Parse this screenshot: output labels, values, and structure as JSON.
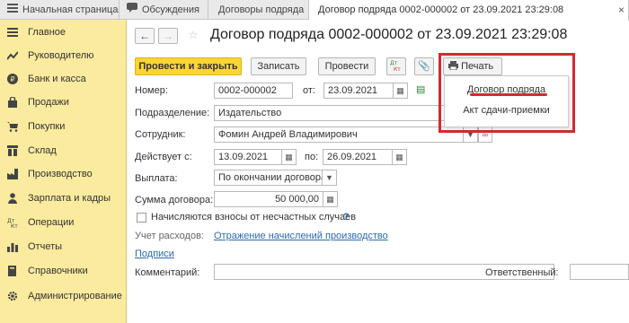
{
  "tabs": [
    {
      "label": "Начальная страница",
      "active": false
    },
    {
      "label": "Обсуждения",
      "active": false
    },
    {
      "label": "Договоры подряда",
      "active": false
    },
    {
      "label": "Договор подряда 0002-000002 от 23.09.2021 23:29:08",
      "active": true
    }
  ],
  "tab_close": "×",
  "sidebar": {
    "items": [
      {
        "label": "Главное",
        "icon": "menu-icon"
      },
      {
        "label": "Руководителю",
        "icon": "chart-trend-icon"
      },
      {
        "label": "Банк и касса",
        "icon": "coin-icon"
      },
      {
        "label": "Продажи",
        "icon": "bag-icon"
      },
      {
        "label": "Покупки",
        "icon": "cart-icon"
      },
      {
        "label": "Склад",
        "icon": "warehouse-icon"
      },
      {
        "label": "Производство",
        "icon": "factory-icon"
      },
      {
        "label": "Зарплата и кадры",
        "icon": "people-icon"
      },
      {
        "label": "Операции",
        "icon": "dt-kt-icon"
      },
      {
        "label": "Отчеты",
        "icon": "bar-chart-icon"
      },
      {
        "label": "Справочники",
        "icon": "book-icon"
      },
      {
        "label": "Администрирование",
        "icon": "gear-icon"
      }
    ]
  },
  "header": {
    "title": "Договор подряда 0002-000002 от 23.09.2021 23:29:08"
  },
  "toolbar": {
    "post_close": "Провести и закрыть",
    "save": "Записать",
    "post": "Провести",
    "dtkt": "Дт Кт",
    "print": "Печать"
  },
  "form": {
    "number_label": "Номер:",
    "number_value": "0002-000002",
    "from_label": "от:",
    "date_value": "23.09.2021",
    "division_label": "Подразделение:",
    "division_value": "Издательство",
    "employee_label": "Сотрудник:",
    "employee_value": "Фомин Андрей Владимирович",
    "valid_from_label": "Действует с:",
    "valid_from_value": "13.09.2021",
    "valid_to_label": "по:",
    "valid_to_value": "26.09.2021",
    "payment_label": "Выплата:",
    "payment_value": "По окончании договора",
    "sum_label": "Сумма договора:",
    "sum_value": "50 000,00",
    "accident_label": "Начисляются взносы от несчастных случаев",
    "help": "?",
    "expense_label": "Учет расходов:",
    "expense_link": "Отражение начислений производство",
    "signatures_link": "Подписи",
    "comment_label": "Комментарий:",
    "responsible_label": "Ответственный:"
  },
  "print_menu": {
    "items": [
      "Договор подряда",
      "Акт сдачи-приемки"
    ]
  },
  "colors": {
    "sidebar_bg": "#fbeb9e",
    "primary_button": "#fcd532",
    "link": "#2a6ab2",
    "highlight": "#d52a2a"
  }
}
